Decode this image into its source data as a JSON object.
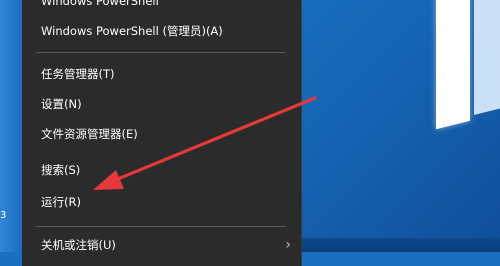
{
  "menu": {
    "items": [
      {
        "label": "Windows PowerShell"
      },
      {
        "label": "Windows PowerShell (管理员)(A)"
      },
      {
        "label": "任务管理器(T)"
      },
      {
        "label": "设置(N)"
      },
      {
        "label": "文件资源管理器(E)"
      },
      {
        "label": "搜索(S)"
      },
      {
        "label": "运行(R)"
      },
      {
        "label": "关机或注销(U)"
      }
    ],
    "submenu_chevron": "›"
  },
  "desktop": {
    "edge_text": "3"
  },
  "colors": {
    "menu_bg": "#2b2b2b",
    "separator": "#5a5a5a",
    "desktop": "#1a6fc0",
    "arrow": "#e8383a"
  }
}
